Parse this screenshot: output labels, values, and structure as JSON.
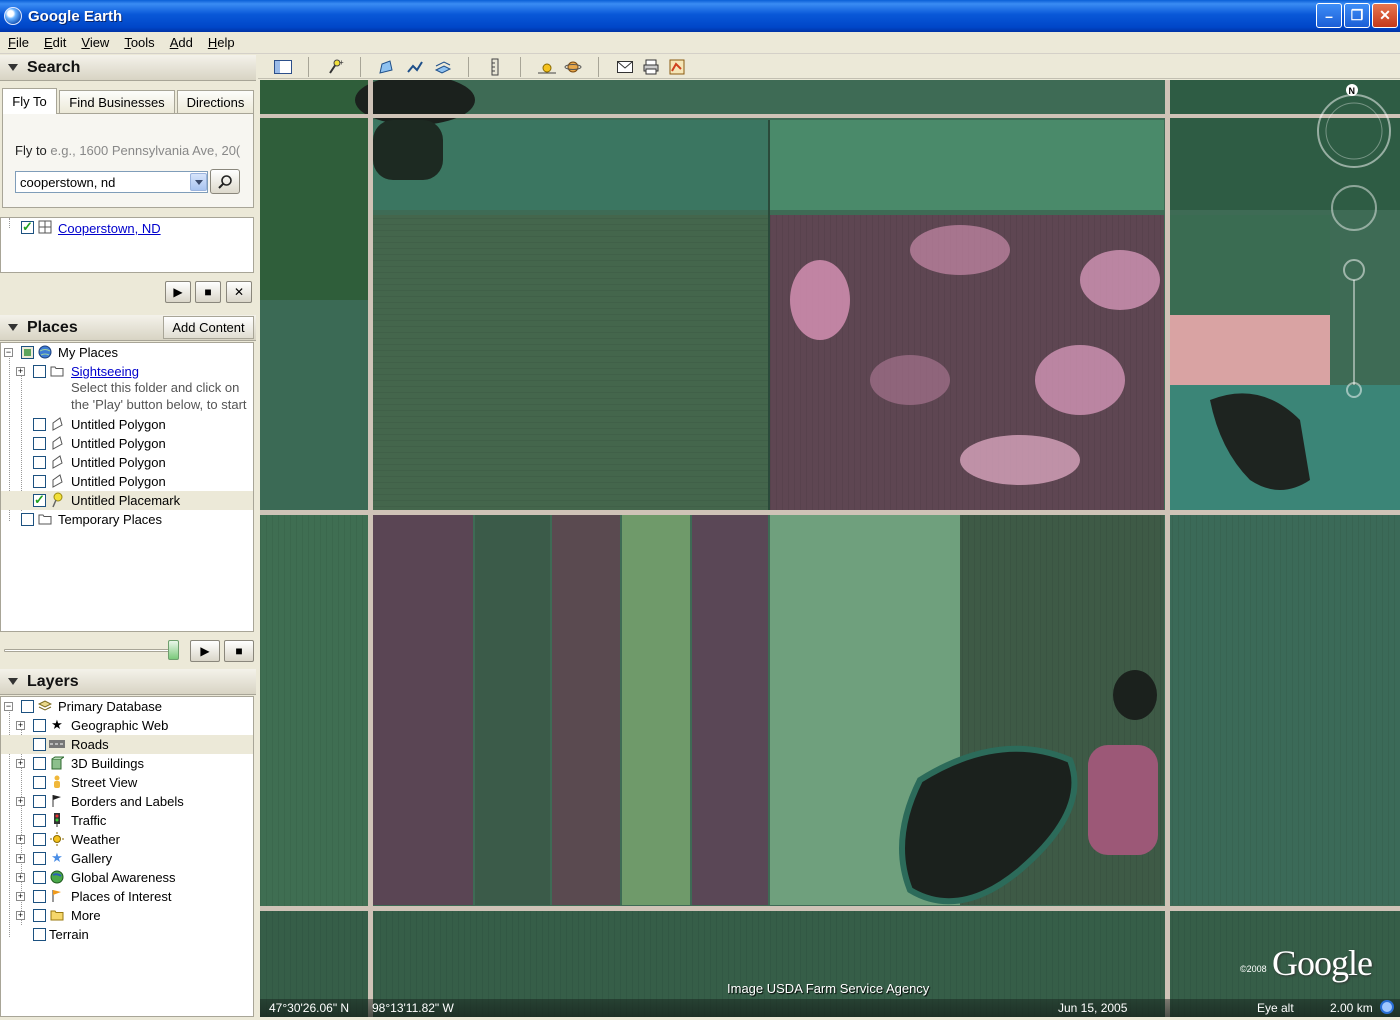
{
  "window": {
    "title": "Google Earth",
    "minimize": "–",
    "maximize": "❐",
    "close": "✕"
  },
  "menu": [
    {
      "first": "F",
      "rest": "ile"
    },
    {
      "first": "E",
      "rest": "dit"
    },
    {
      "first": "V",
      "rest": "iew"
    },
    {
      "first": "T",
      "rest": "ools"
    },
    {
      "first": "A",
      "rest": "dd"
    },
    {
      "first": "H",
      "rest": "elp"
    }
  ],
  "search": {
    "header": "Search",
    "tabs": [
      "Fly To",
      "Find Businesses",
      "Directions"
    ],
    "fly_label": "Fly to",
    "fly_example": "e.g., 1600 Pennsylvania Ave, 20(",
    "query": "cooperstown, nd",
    "result": "Cooperstown, ND"
  },
  "places": {
    "header": "Places",
    "add_content": "Add Content",
    "my_places": "My Places",
    "sightseeing": "Sightseeing",
    "sightseeing_desc_1": "Select this folder and click on",
    "sightseeing_desc_2": "the 'Play' button below, to start",
    "items": [
      "Untitled Polygon",
      "Untitled Polygon",
      "Untitled Polygon",
      "Untitled Polygon",
      "Untitled Placemark"
    ],
    "temporary": "Temporary Places"
  },
  "layers": {
    "header": "Layers",
    "root": "Primary Database",
    "items": [
      "Geographic Web",
      "Roads",
      "3D Buildings",
      "Street View",
      "Borders and Labels",
      "Traffic",
      "Weather",
      "Gallery",
      "Global Awareness",
      "Places of Interest",
      "More"
    ],
    "terrain": "Terrain"
  },
  "controls": {
    "play": "▶",
    "stop": "■",
    "close": "✕"
  },
  "map": {
    "lat": "47°30'26.06\" N",
    "lon": "98°13'11.82\" W",
    "date": "Jun 15, 2005",
    "eye_alt_label": "Eye alt",
    "eye_alt": "2.00 km",
    "credit": "Image USDA Farm Service Agency",
    "copyright": "©2008",
    "logo": "Google",
    "compass_n": "N"
  }
}
